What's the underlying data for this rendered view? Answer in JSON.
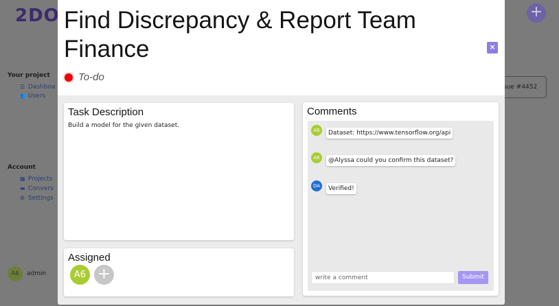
{
  "background": {
    "logo": "2DO",
    "add_icon": "plus-icon",
    "your_project_heading": "Your project",
    "project_links": [
      {
        "label": "Dashboa",
        "icon": "list-icon"
      },
      {
        "label": "Users",
        "icon": "users-icon"
      }
    ],
    "account_heading": "Account",
    "account_links": [
      {
        "label": "Projects",
        "icon": "table-icon"
      },
      {
        "label": "Convers",
        "icon": "chat-icon"
      },
      {
        "label": "Settings",
        "icon": "gear-icon"
      }
    ],
    "issue_button": "sue #4452",
    "user": {
      "initials": "A6",
      "name": "admin"
    }
  },
  "modal": {
    "title": "Find Discrepancy & Report Team Finance",
    "close_label": "×",
    "status": {
      "label": "To-do",
      "color": "#ee0000"
    },
    "description": {
      "heading": "Task Description",
      "text": "Build a model for the given dataset."
    },
    "assigned": {
      "heading": "Assigned",
      "assignees": [
        {
          "initials": "A6",
          "color": "#aacc33"
        }
      ],
      "add_label": "+"
    },
    "comments": {
      "heading": "Comments",
      "items": [
        {
          "initials": "A6",
          "color": "#aacc33",
          "text": "Dataset: https://www.tensorflow.org/api"
        },
        {
          "initials": "A6",
          "color": "#aacc33",
          "text": "@Alyssa could you confirm this dataset?"
        },
        {
          "initials": "DA",
          "color": "#1f6fd0",
          "text": "Verified!"
        }
      ],
      "input_placeholder": "write a comment",
      "submit_label": "Submit"
    }
  },
  "colors": {
    "accent": "#8c7fe0",
    "submit": "#a596f2"
  }
}
